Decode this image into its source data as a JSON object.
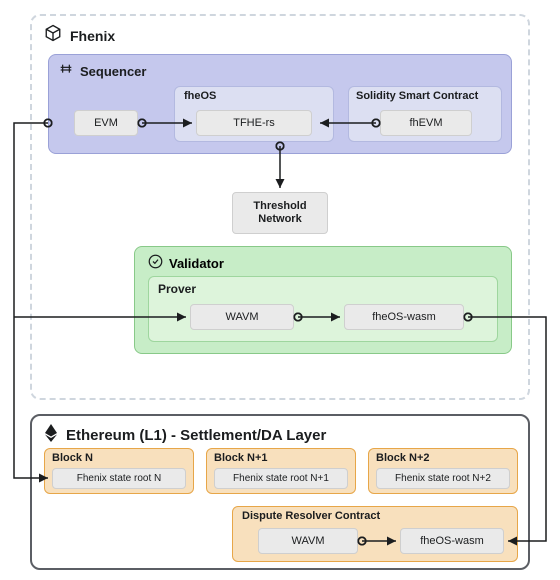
{
  "fhenix": {
    "title": "Fhenix"
  },
  "sequencer": {
    "title": "Sequencer",
    "evm": "EVM",
    "fheos": {
      "label": "fheOS",
      "tfhe": "TFHE-rs"
    },
    "contract": {
      "label": "Solidity Smart Contract",
      "fhevm": "fhEVM"
    }
  },
  "threshold": {
    "label1": "Threshold",
    "label2": "Network"
  },
  "validator": {
    "title": "Validator",
    "prover": {
      "label": "Prover",
      "wavm": "WAVM",
      "fheos_wasm": "fheOS-wasm"
    }
  },
  "ethereum": {
    "title": "Ethereum (L1) - Settlement/DA Layer",
    "blocks": [
      {
        "name": "Block N",
        "state": "Fhenix state root N"
      },
      {
        "name": "Block N+1",
        "state": "Fhenix state root N+1"
      },
      {
        "name": "Block N+2",
        "state": "Fhenix state root N+2"
      }
    ],
    "dispute": {
      "label": "Dispute Resolver Contract",
      "wavm": "WAVM",
      "fheos_wasm": "fheOS-wasm"
    }
  }
}
